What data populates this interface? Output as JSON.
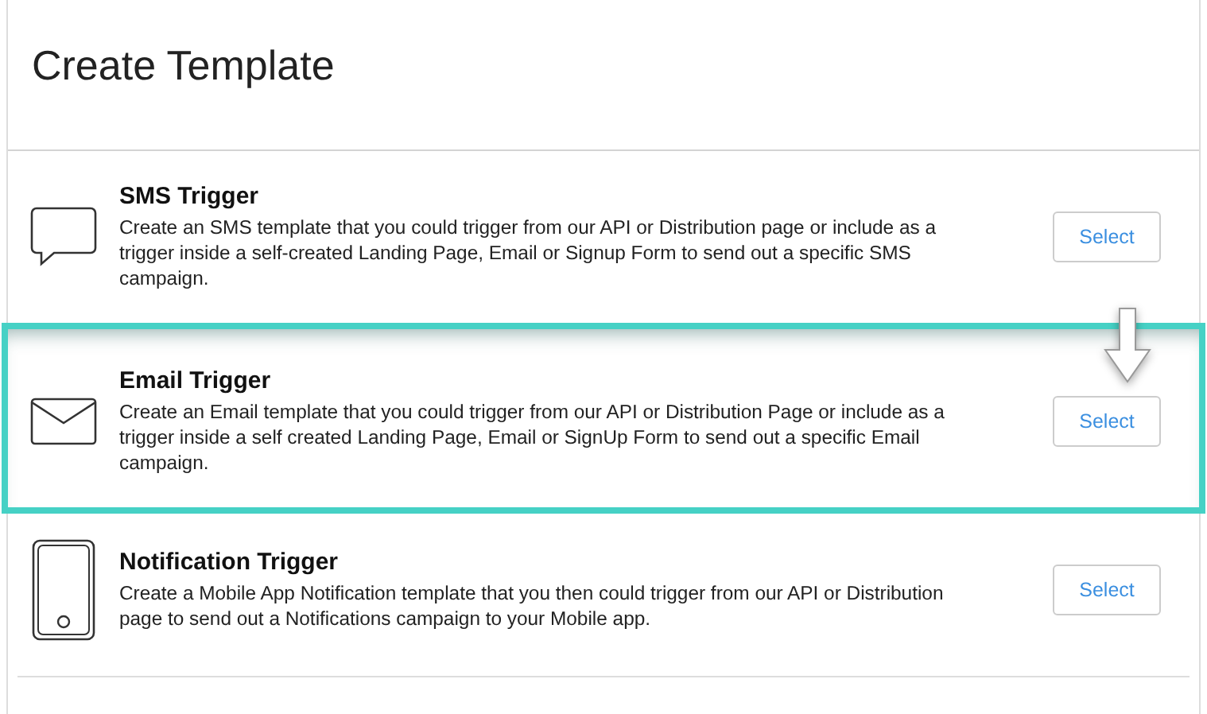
{
  "title": "Create Template",
  "templates": [
    {
      "kind": "chat",
      "name": "SMS Trigger",
      "description": "Create an SMS template that you could trigger from our API or Distribution page or include as a trigger inside a self-created Landing Page, Email or Signup Form to send out a specific SMS campaign.",
      "button": "Select",
      "highlighted": false
    },
    {
      "kind": "envelope",
      "name": "Email Trigger",
      "description": "Create an Email template that you could trigger from our API or Distribution Page or include as a trigger inside a self created Landing Page, Email or SignUp Form to send out a specific Email campaign.",
      "button": "Select",
      "highlighted": true
    },
    {
      "kind": "phone",
      "name": "Notification Trigger",
      "description": "Create a Mobile App Notification template that you then could trigger from our API or Distribution page to send out a Notifications campaign to your Mobile app.",
      "button": "Select",
      "highlighted": false
    }
  ]
}
